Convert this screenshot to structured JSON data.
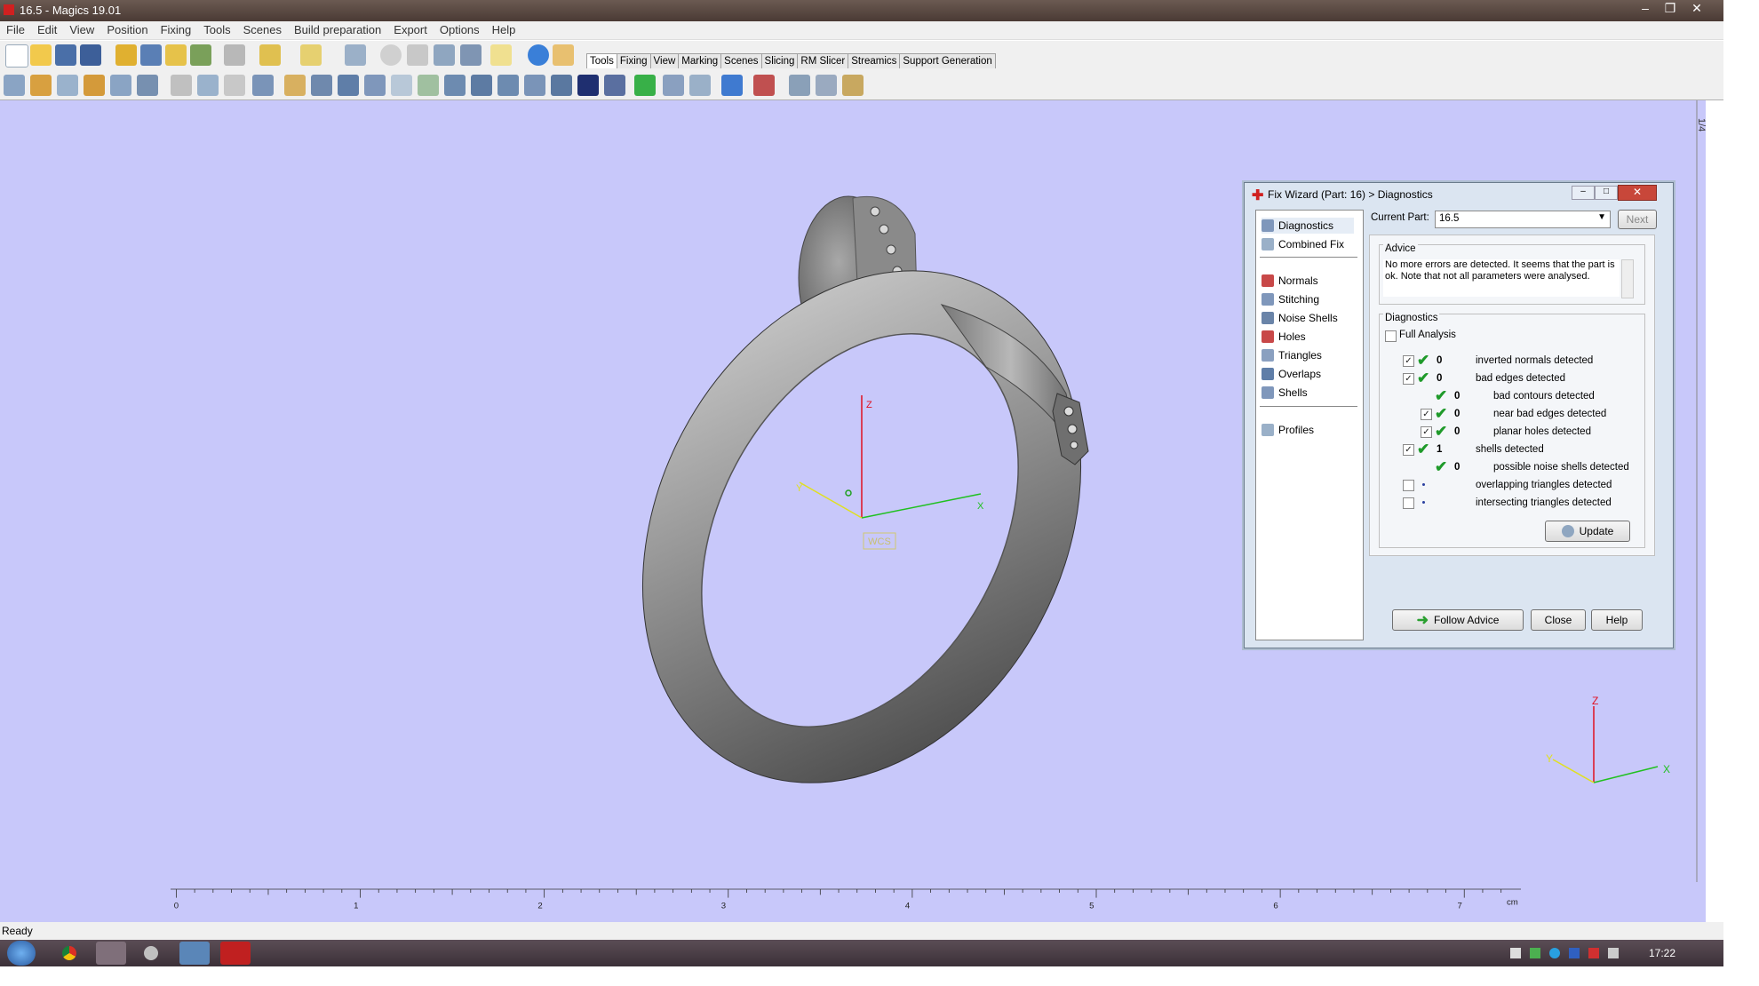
{
  "window": {
    "title": "16.5 - Magics 19.01"
  },
  "menu": [
    "File",
    "Edit",
    "View",
    "Position",
    "Fixing",
    "Tools",
    "Scenes",
    "Build preparation",
    "Export",
    "Options",
    "Help"
  ],
  "tabs": [
    "Tools",
    "Fixing",
    "View",
    "Marking",
    "Scenes",
    "Slicing",
    "RM Slicer",
    "Streamics",
    "Support Generation"
  ],
  "viewport": {
    "wcs_label": "WCS",
    "axis_z": "Z",
    "axis_x": "X",
    "axis_y": "Y",
    "ruler_ticks": [
      "0",
      "1",
      "2",
      "3",
      "4",
      "5",
      "6",
      "7"
    ],
    "ruler_unit": "cm",
    "side_marker": "1/4"
  },
  "dialog": {
    "title": "Fix Wizard (Part: 16) > Diagnostics",
    "nav": [
      "Diagnostics",
      "Combined Fix",
      "Normals",
      "Stitching",
      "Noise Shells",
      "Holes",
      "Triangles",
      "Overlaps",
      "Shells",
      "Profiles"
    ],
    "current_part_label": "Current Part:",
    "current_part_value": "16.5",
    "next_label": "Next",
    "advice_title": "Advice",
    "advice_text": "No more errors are detected. It seems that the part is ok. Note that not all parameters were analysed.",
    "diagnostics_title": "Diagnostics",
    "full_analysis_label": "Full Analysis",
    "rows": [
      {
        "value": "0",
        "label": "inverted normals detected"
      },
      {
        "value": "0",
        "label": "bad edges detected"
      },
      {
        "value": "0",
        "label": "bad contours detected"
      },
      {
        "value": "0",
        "label": "near bad edges detected"
      },
      {
        "value": "0",
        "label": "planar holes detected"
      },
      {
        "value": "1",
        "label": "shells detected"
      },
      {
        "value": "0",
        "label": "possible noise shells detected"
      },
      {
        "value": "",
        "label": "overlapping triangles detected"
      },
      {
        "value": "",
        "label": "intersecting triangles detected"
      }
    ],
    "update_label": "Update",
    "follow_advice_label": "Follow Advice",
    "close_label": "Close",
    "help_label": "Help"
  },
  "status": {
    "text": "Ready"
  },
  "taskbar": {
    "time": "17:22"
  },
  "colors": {
    "viewport_bg": "#c8c8fa",
    "check_green": "#1f9a2a"
  }
}
